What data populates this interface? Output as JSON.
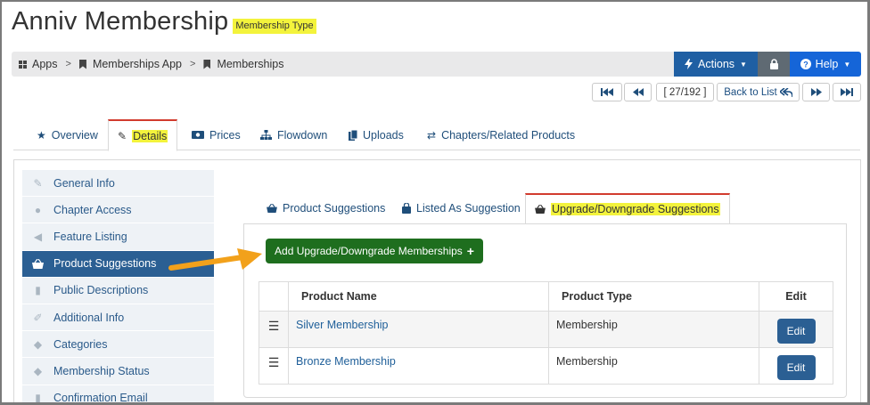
{
  "page": {
    "title": "Anniv Membership",
    "type_badge": "Membership Type"
  },
  "breadcrumb": {
    "items": [
      "Apps",
      "Memberships App",
      "Memberships"
    ],
    "separator": ">"
  },
  "toolbar": {
    "actions_label": "Actions",
    "help_label": "Help"
  },
  "pager": {
    "first": "⏮",
    "prev": "◀◀",
    "counter": "[ 27/192 ]",
    "back_to_list": "Back to List",
    "next": "▶▶",
    "last": "⏭"
  },
  "main_tabs": [
    {
      "label": "Overview",
      "icon": "star-icon"
    },
    {
      "label": "Details",
      "icon": "edit-icon",
      "active": true
    },
    {
      "label": "Prices",
      "icon": "money-icon"
    },
    {
      "label": "Flowdown",
      "icon": "sitemap-icon"
    },
    {
      "label": "Uploads",
      "icon": "files-icon"
    },
    {
      "label": "Chapters/Related Products",
      "icon": "retweet-icon"
    }
  ],
  "sidenav": [
    {
      "label": "General Info",
      "icon": "edit-icon"
    },
    {
      "label": "Chapter Access",
      "icon": "user-icon"
    },
    {
      "label": "Feature Listing",
      "icon": "megaphone-icon"
    },
    {
      "label": "Product Suggestions",
      "icon": "basket-icon",
      "active": true
    },
    {
      "label": "Public Descriptions",
      "icon": "file-icon"
    },
    {
      "label": "Additional Info",
      "icon": "pencil-icon"
    },
    {
      "label": "Categories",
      "icon": "tags-icon"
    },
    {
      "label": "Membership Status",
      "icon": "tag-icon"
    },
    {
      "label": "Confirmation Email",
      "icon": "file-icon"
    }
  ],
  "sub_tabs": [
    {
      "label": "Product Suggestions",
      "icon": "basket-icon"
    },
    {
      "label": "Listed As Suggestion",
      "icon": "shopping-bag-icon"
    },
    {
      "label": "Upgrade/Downgrade Suggestions",
      "icon": "basket-icon",
      "active": true
    }
  ],
  "add_button": {
    "label": "Add Upgrade/Downgrade Memberships",
    "icon": "plus-icon"
  },
  "table": {
    "headers": [
      "",
      "Product Name",
      "Product Type",
      "Edit"
    ],
    "rows": [
      {
        "name": "Silver Membership",
        "type": "Membership",
        "edit": "Edit"
      },
      {
        "name": "Bronze Membership",
        "type": "Membership",
        "edit": "Edit"
      }
    ]
  },
  "colors": {
    "accent_blue": "#1f5fa3",
    "help_blue": "#1565d8",
    "active_nav": "#2b5f93",
    "add_button_green": "#1e6e1e",
    "highlight_yellow": "#f3f33c",
    "arrow_orange": "#f2a11b",
    "tab_active_red": "#d23b2e"
  }
}
